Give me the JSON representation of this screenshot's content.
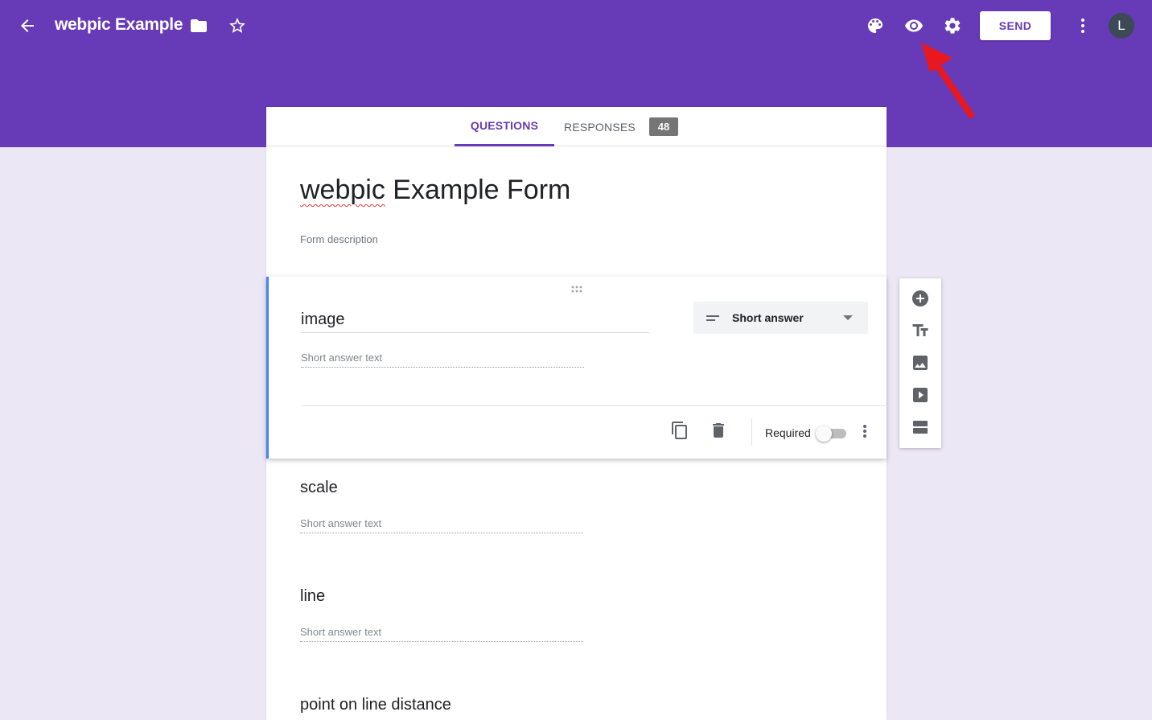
{
  "header": {
    "app_title": "webpic Example",
    "send_label": "SEND",
    "avatar_initial": "L",
    "icons": [
      "back-arrow-icon",
      "folder-icon",
      "star-icon",
      "palette-icon",
      "preview-eye-icon",
      "settings-gear-icon",
      "more-vert-icon"
    ]
  },
  "colors": {
    "brand": "#673ab7",
    "active_question": "#4285f4",
    "background": "#ece7f5",
    "annotation_arrow": "#e8181e"
  },
  "tabs": {
    "questions_label": "QUESTIONS",
    "responses_label": "RESPONSES",
    "responses_count": "48",
    "active": "QUESTIONS"
  },
  "form": {
    "title_spell": "webpic",
    "title_rest": " Example Form",
    "description_placeholder": "Form description"
  },
  "questions": [
    {
      "title": "image",
      "answer_placeholder": "Short answer text",
      "type_label": "Short answer",
      "required_label": "Required",
      "required": false
    },
    {
      "title": "scale",
      "answer_placeholder": "Short answer text"
    },
    {
      "title": "line",
      "answer_placeholder": "Short answer text"
    },
    {
      "title": "point on line distance"
    }
  ],
  "side_toolbar": [
    "add-question-icon",
    "add-title-icon",
    "add-image-icon",
    "add-video-icon",
    "add-section-icon"
  ]
}
